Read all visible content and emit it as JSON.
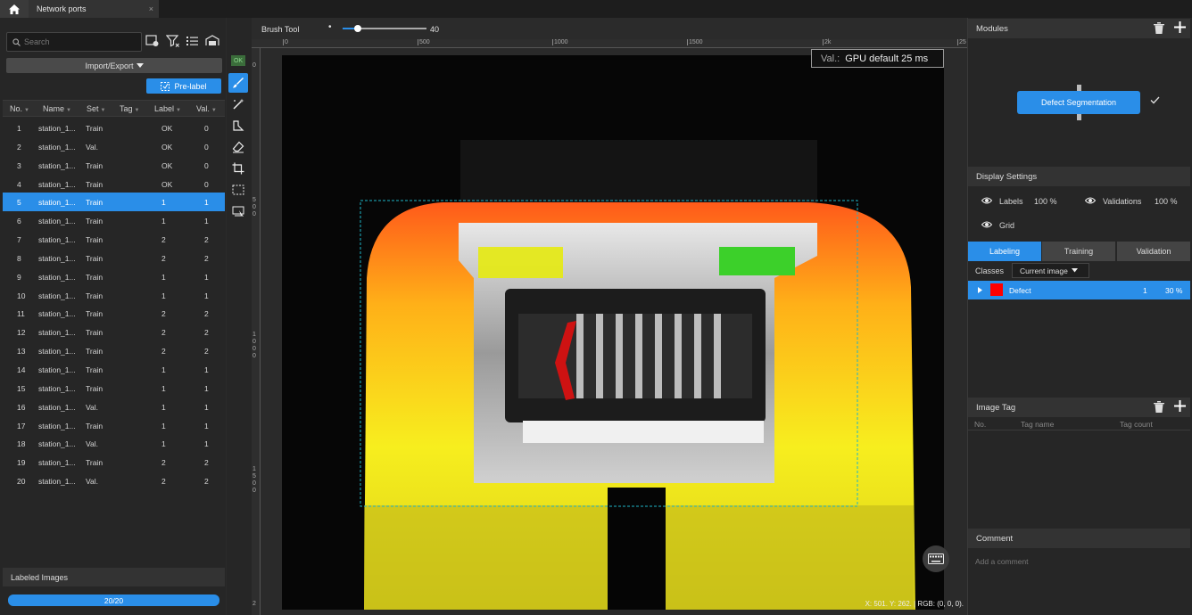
{
  "window": {
    "tab_title": "Network ports",
    "tab_close": "×"
  },
  "left": {
    "search_placeholder": "Search",
    "import_export": "Import/Export",
    "pre_label": "Pre-label",
    "columns": [
      "No.",
      "Name",
      "Set",
      "Tag",
      "Label",
      "Val."
    ],
    "rows": [
      {
        "no": "1",
        "name": "station_1...",
        "set": "Train",
        "tag": "",
        "label": "OK",
        "val": "0"
      },
      {
        "no": "2",
        "name": "station_1...",
        "set": "Val.",
        "tag": "",
        "label": "OK",
        "val": "0"
      },
      {
        "no": "3",
        "name": "station_1...",
        "set": "Train",
        "tag": "",
        "label": "OK",
        "val": "0"
      },
      {
        "no": "4",
        "name": "station_1...",
        "set": "Train",
        "tag": "",
        "label": "OK",
        "val": "0"
      },
      {
        "no": "5",
        "name": "station_1...",
        "set": "Train",
        "tag": "",
        "label": "1",
        "val": "1"
      },
      {
        "no": "6",
        "name": "station_1...",
        "set": "Train",
        "tag": "",
        "label": "1",
        "val": "1"
      },
      {
        "no": "7",
        "name": "station_1...",
        "set": "Train",
        "tag": "",
        "label": "2",
        "val": "2"
      },
      {
        "no": "8",
        "name": "station_1...",
        "set": "Train",
        "tag": "",
        "label": "2",
        "val": "2"
      },
      {
        "no": "9",
        "name": "station_1...",
        "set": "Train",
        "tag": "",
        "label": "1",
        "val": "1"
      },
      {
        "no": "10",
        "name": "station_1...",
        "set": "Train",
        "tag": "",
        "label": "1",
        "val": "1"
      },
      {
        "no": "11",
        "name": "station_1...",
        "set": "Train",
        "tag": "",
        "label": "2",
        "val": "2"
      },
      {
        "no": "12",
        "name": "station_1...",
        "set": "Train",
        "tag": "",
        "label": "2",
        "val": "2"
      },
      {
        "no": "13",
        "name": "station_1...",
        "set": "Train",
        "tag": "",
        "label": "2",
        "val": "2"
      },
      {
        "no": "14",
        "name": "station_1...",
        "set": "Train",
        "tag": "",
        "label": "1",
        "val": "1"
      },
      {
        "no": "15",
        "name": "station_1...",
        "set": "Train",
        "tag": "",
        "label": "1",
        "val": "1"
      },
      {
        "no": "16",
        "name": "station_1...",
        "set": "Val.",
        "tag": "",
        "label": "1",
        "val": "1"
      },
      {
        "no": "17",
        "name": "station_1...",
        "set": "Train",
        "tag": "",
        "label": "1",
        "val": "1"
      },
      {
        "no": "18",
        "name": "station_1...",
        "set": "Val.",
        "tag": "",
        "label": "1",
        "val": "1"
      },
      {
        "no": "19",
        "name": "station_1...",
        "set": "Train",
        "tag": "",
        "label": "2",
        "val": "2"
      },
      {
        "no": "20",
        "name": "station_1...",
        "set": "Val.",
        "tag": "",
        "label": "2",
        "val": "2"
      }
    ],
    "selected_row": 5,
    "labeled_images": "Labeled Images",
    "progress_text": "20/20",
    "progress": 1.0
  },
  "toolbar": {
    "ok_badge": "OK",
    "brush_tool": "Brush Tool",
    "brush_size": "40",
    "brush_fraction": 0.18,
    "ruler_top": [
      "0",
      "500",
      "1000",
      "1500",
      "2k",
      "25"
    ],
    "ruler_left": [
      "0",
      "5\n0\n0",
      "1\n0\n0\n0",
      "1\n5\n0\n0",
      "2"
    ]
  },
  "canvas": {
    "val_prefix": "Val.:",
    "val_text": "GPU default 25 ms",
    "coords": "X: 501. Y: 262. | RGB: (0, 0, 0)."
  },
  "right": {
    "modules_title": "Modules",
    "module_button": "Defect Segmentation",
    "display_settings": "Display Settings",
    "labels": "Labels",
    "labels_pct": "100 %",
    "validations": "Validations",
    "validations_pct": "100 %",
    "grid": "Grid",
    "tabs": [
      "Labeling",
      "Training",
      "Validation"
    ],
    "classes_label": "Classes",
    "classes_select": "Current image",
    "class_row": {
      "name": "Defect",
      "count": "1",
      "pct": "30 %",
      "color": "#ff0000"
    },
    "image_tag": "Image Tag",
    "tag_cols": [
      "No.",
      "Tag name",
      "Tag count"
    ],
    "comment_title": "Comment",
    "comment_placeholder": "Add a comment"
  },
  "colors": {
    "accent": "#2a8ee8",
    "panel": "#262626"
  }
}
